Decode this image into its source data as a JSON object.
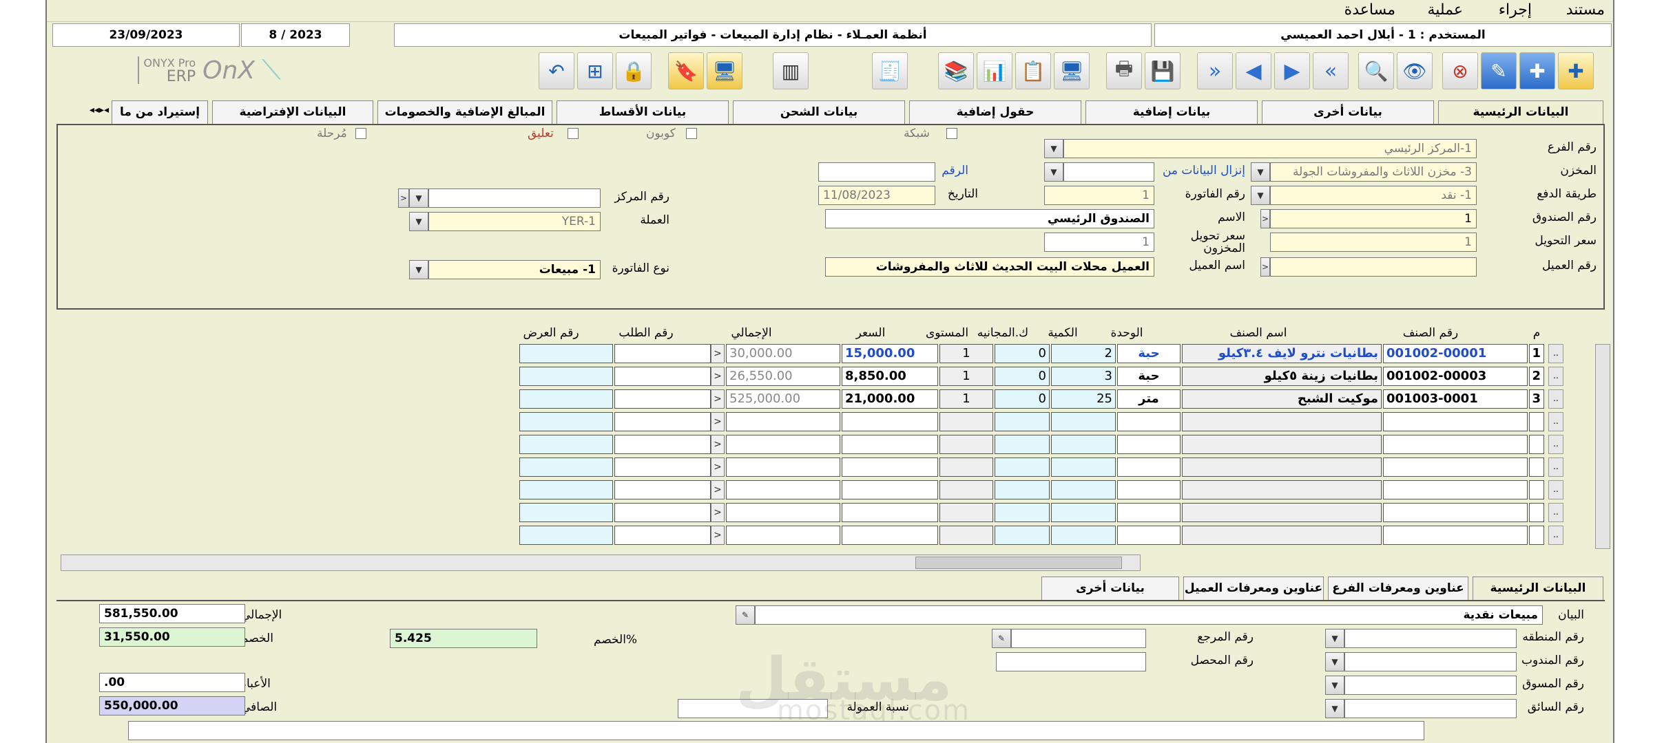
{
  "menu": [
    "مستند",
    "إجراء",
    "عملية",
    "مساعدة"
  ],
  "infobar": {
    "user": "المستخدم : 1 - أبلال احمد العميسي",
    "system_title": "أنظمة العمـلاء - نظام إدارة المبيعات - فواتير المبيعات",
    "period": "2023 / 8",
    "date": "23/09/2023"
  },
  "logo": {
    "brand": "OnX",
    "line1": "ONYX Pro",
    "line2": "ERP"
  },
  "tabs_top": [
    "البيانات الرئيسية",
    "بيانات أخرى",
    "بيانات إضافية",
    "حقول إضافية",
    "بيانات الشحن",
    "بيانات الأقساط",
    "المبالغ الإضافية والخصومات",
    "البيانات الإفتراضية",
    "إستيراد من ما"
  ],
  "header_form": {
    "branch_label": "رقم الفرع",
    "branch_value": "1-المركز الرئيسي",
    "store_label": "المخزن",
    "store_value": "3- مخزن اللاثاث والمفروشات الجولة",
    "download_label": "إنزال البيانات من",
    "number_label": "الرقم",
    "number_value": "",
    "payment_label": "طريقة الدفع",
    "payment_value": "1- نقد",
    "invoice_no_label": "رقم الفاتورة",
    "invoice_no_value": "1",
    "date_label": "التاريخ",
    "date_value": "11/08/2023",
    "center_label": "رقم المركز",
    "center_value": "",
    "box_label": "رقم الصندوق",
    "box_value": "1",
    "name_label": "الاسم",
    "name_value": "الصندوق الرئيسي",
    "currency_label": "العملة",
    "currency_value": "YER-1",
    "transfer_rate_label": "سعر التحويل",
    "transfer_rate_value": "1",
    "store_rate_label": "سعر تحويل المخزون",
    "store_rate_value": "1",
    "client_no_label": "رقم العميل",
    "client_no_value": "",
    "client_name_label": "اسم العميل",
    "client_name_value": "العميل محلات البيت الحديث للاثاث والمفروشات",
    "invoice_type_label": "نوع الفاتورة",
    "invoice_type_value": "1- مبيعات",
    "checks": [
      "شبكة",
      "كوبون",
      "تعليق",
      "مُرحلة"
    ]
  },
  "grid": {
    "columns": [
      "م",
      "رقم الصنف",
      "اسم الصنف",
      "الوحدة",
      "الكمية",
      "ك.المجانيه",
      "المستوى",
      "السعر",
      "الإجمالي",
      "رقم الطلب",
      "رقم العرض"
    ],
    "rows": [
      {
        "n": "1",
        "code": "001002-00001",
        "name": "بطانيات نترو لايف ٣.٤كيلو",
        "unit": "حبة",
        "qty": "2",
        "free": "0",
        "level": "1",
        "price": "15,000.00",
        "total": "30,000.00"
      },
      {
        "n": "2",
        "code": "001002-00003",
        "name": "بطانيات زينة ٥كيلو",
        "unit": "حبة",
        "qty": "3",
        "free": "0",
        "level": "1",
        "price": "8,850.00",
        "total": "26,550.00"
      },
      {
        "n": "3",
        "code": "001003-0001",
        "name": "موكيت الشبح",
        "unit": "متر",
        "qty": "25",
        "free": "0",
        "level": "1",
        "price": "21,000.00",
        "total": "525,000.00"
      }
    ]
  },
  "tabs_bottom": [
    "البيانات الرئيسية",
    "عناوين ومعرفات الفرع",
    "عناوين ومعرفات العميل",
    "بيانات أخرى"
  ],
  "footer": {
    "statement_label": "البيان",
    "statement_value": "مبيعات نقدية",
    "region_label": "رقم المنطقه",
    "ref_label": "رقم المرجع",
    "rep_label": "رقم المندوب",
    "collector_label": "رقم المحصل",
    "marketer_label": "رقم المسوق",
    "driver_label": "رقم السائق",
    "commission_label": "نسبة العمولة",
    "discount_pct_label": "%الخصم",
    "discount_pct_value": "5.425",
    "total_label": "الإجمالي",
    "total_value": "581,550.00",
    "discount_label": "الخصم",
    "discount_value": "31,550.00",
    "burdens_label": "الأعباء",
    "burdens_value": ".00",
    "net_label": "الصافي",
    "net_value": "550,000.00"
  },
  "watermark": {
    "ar": "مستقل",
    "en": "mostaql.com"
  }
}
